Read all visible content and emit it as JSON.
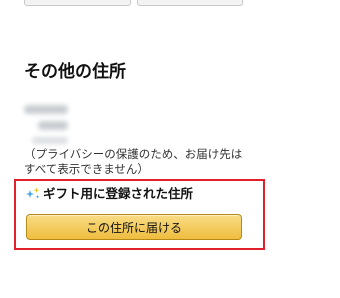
{
  "section": {
    "title": "その他の住所"
  },
  "address": {
    "privacy_note": "（プライバシーの保護のため、お届け先はすべて表示できません）",
    "gift_label": "ギフト用に登録された住所",
    "gift_icon": "sparkle-icon",
    "deliver_button_label": "この住所に届ける"
  },
  "colors": {
    "highlight_border": "#e0202a",
    "button_gradient_top": "#f8dc85",
    "button_gradient_bottom": "#efbd3f",
    "sparkle_blue": "#4aa7e8",
    "sparkle_yellow": "#f0c419"
  }
}
